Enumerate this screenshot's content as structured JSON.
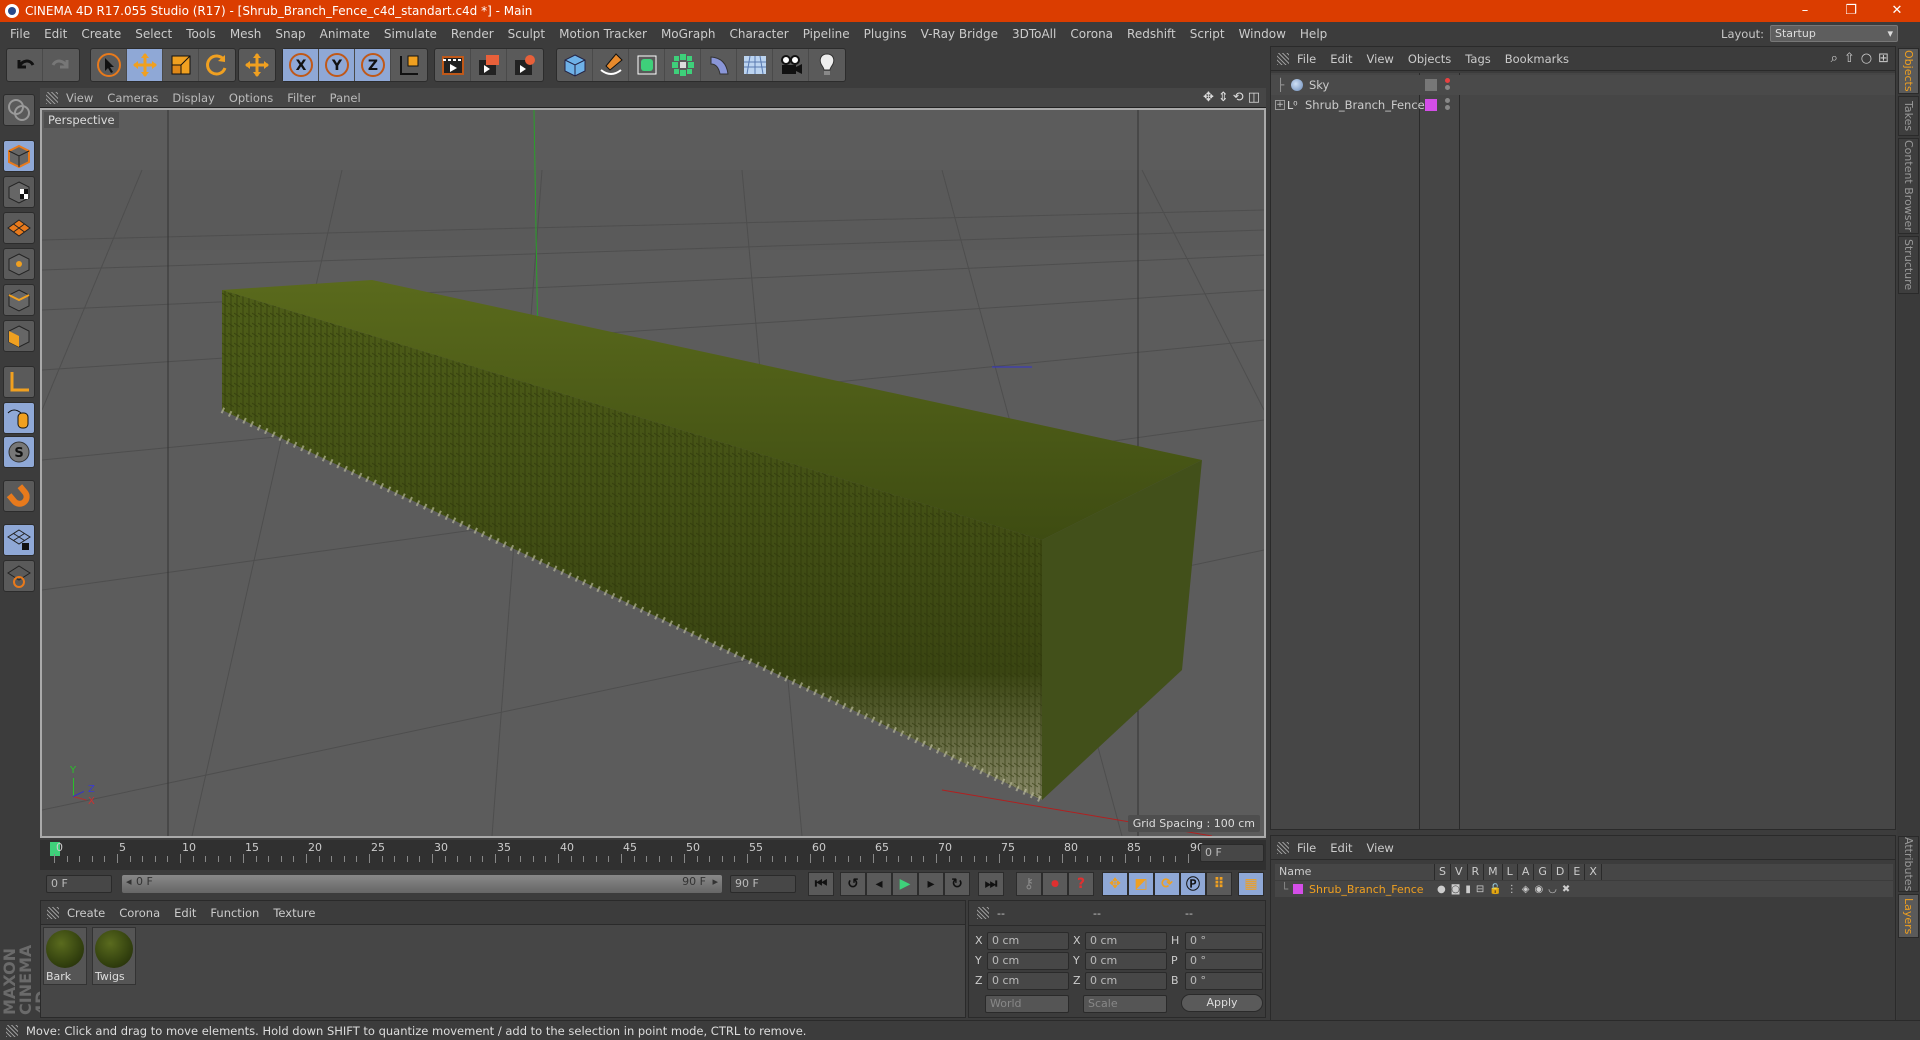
{
  "window": {
    "title": "CINEMA 4D R17.055 Studio (R17) - [Shrub_Branch_Fence_c4d_standart.c4d *] - Main",
    "controls": [
      "–",
      "❐",
      "✕"
    ]
  },
  "menubar": {
    "items": [
      "File",
      "Edit",
      "Create",
      "Select",
      "Tools",
      "Mesh",
      "Snap",
      "Animate",
      "Simulate",
      "Render",
      "Sculpt",
      "Motion Tracker",
      "MoGraph",
      "Character",
      "Pipeline",
      "Plugins",
      "V-Ray Bridge",
      "3DToAll",
      "Corona",
      "Redshift",
      "Script",
      "Window",
      "Help"
    ],
    "layout_label": "Layout:",
    "layout_value": "Startup"
  },
  "toolbar": {
    "groups": [
      {
        "tools": [
          "undo-icon",
          "redo-icon"
        ]
      },
      {
        "tools": [
          "live-selection-icon",
          "move-icon",
          "scale-icon",
          "rotate-icon"
        ]
      },
      {
        "tools": [
          "last-tool-move-icon"
        ]
      },
      {
        "tools": [
          "x-axis-icon",
          "y-axis-icon",
          "z-axis-icon",
          "coordinate-system-icon"
        ]
      },
      {
        "tools": [
          "render-view-icon",
          "render-picture-viewer-icon",
          "render-settings-icon"
        ]
      },
      {
        "tools": [
          "cube-icon",
          "pen-spline-icon",
          "subdivision-icon",
          "cloner-icon",
          "deformer-icon",
          "floor-icon",
          "camera-icon",
          "light-icon"
        ]
      }
    ],
    "axis_labels": [
      "X",
      "Y",
      "Z"
    ]
  },
  "viewport": {
    "menu": [
      "View",
      "Cameras",
      "Display",
      "Options",
      "Filter",
      "Panel"
    ],
    "label": "Perspective",
    "grid_spacing": "Grid Spacing : 100 cm",
    "axis": {
      "x": "X",
      "y": "Y",
      "z": "Z"
    }
  },
  "object_manager": {
    "menu": [
      "File",
      "Edit",
      "View",
      "Objects",
      "Tags",
      "Bookmarks"
    ],
    "objects": [
      {
        "name": "Sky",
        "color": "#888888"
      },
      {
        "name": "Shrub_Branch_Fence",
        "color": "#d44ee8"
      }
    ]
  },
  "right_tabs": {
    "top": [
      "Objects",
      "Takes",
      "Content Browser",
      "Structure"
    ],
    "bottom": [
      "Attributes",
      "Layers"
    ]
  },
  "layer_manager": {
    "menu": [
      "File",
      "Edit",
      "View"
    ],
    "columns": [
      "Name",
      "S",
      "V",
      "R",
      "M",
      "L",
      "A",
      "G",
      "D",
      "E",
      "X"
    ],
    "layers": [
      {
        "name": "Shrub_Branch_Fence",
        "color": "#d44ee8"
      }
    ]
  },
  "timeline": {
    "ticks": [
      "0",
      "5",
      "10",
      "15",
      "20",
      "25",
      "30",
      "35",
      "40",
      "45",
      "50",
      "55",
      "60",
      "65",
      "70",
      "75",
      "80",
      "85",
      "90"
    ],
    "current_frame": "0 F",
    "start_field": "0 F",
    "range_start": "0 F",
    "range_end": "90 F",
    "end_field": "90 F"
  },
  "material_manager": {
    "menu": [
      "Create",
      "Corona",
      "Edit",
      "Function",
      "Texture"
    ],
    "materials": [
      {
        "name": "Bark"
      },
      {
        "name": "Twigs"
      }
    ]
  },
  "coordinates": {
    "headers": [
      "--",
      "--",
      "--"
    ],
    "pos": [
      {
        "label": "X",
        "value": "0 cm"
      },
      {
        "label": "Y",
        "value": "0 cm"
      },
      {
        "label": "Z",
        "value": "0 cm"
      }
    ],
    "size": [
      {
        "label": "X",
        "value": "0 cm"
      },
      {
        "label": "Y",
        "value": "0 cm"
      },
      {
        "label": "Z",
        "value": "0 cm"
      }
    ],
    "rot": [
      {
        "label": "H",
        "value": "0 °"
      },
      {
        "label": "P",
        "value": "0 °"
      },
      {
        "label": "B",
        "value": "0 °"
      }
    ],
    "mode": "World",
    "scale_mode": "Scale",
    "apply": "Apply"
  },
  "brand": "MAXON CINEMA 4D",
  "status": "Move: Click and drag to move elements. Hold down SHIFT to quantize movement / add to the selection in point mode, CTRL to remove.",
  "colors": {
    "accent": "#db3d00",
    "highlight": "#f0a020",
    "active_button": "#8fa8d6"
  }
}
